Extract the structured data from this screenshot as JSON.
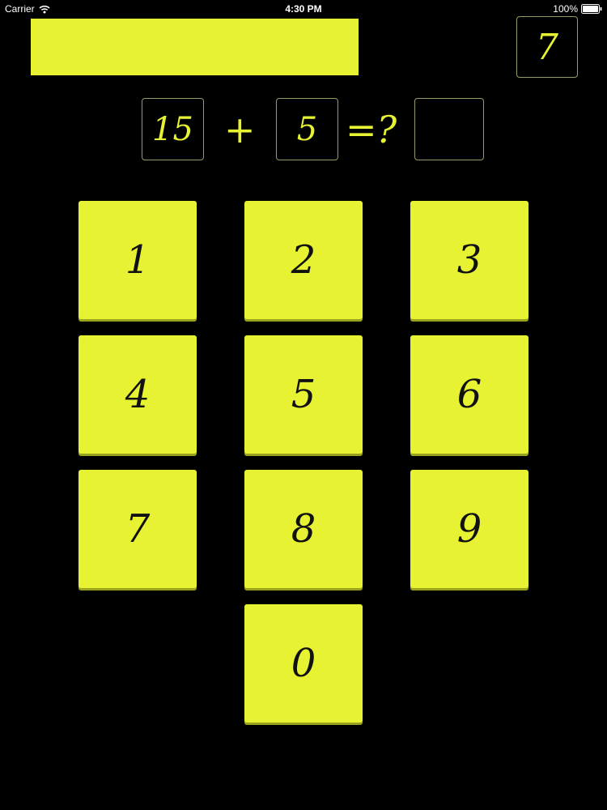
{
  "status_bar": {
    "carrier": "Carrier",
    "time": "4:30 PM",
    "battery": "100%",
    "icons": [
      "wifi-icon",
      "battery-icon"
    ]
  },
  "progress": {
    "fraction": 1.0,
    "color": "#e6f232"
  },
  "score": "7",
  "equation": {
    "operand_a": "15",
    "operator": "+",
    "operand_b": "5",
    "equals": "=?",
    "answer": ""
  },
  "keypad": {
    "keys": [
      "1",
      "2",
      "3",
      "4",
      "5",
      "6",
      "7",
      "8",
      "9",
      "0"
    ]
  },
  "colors": {
    "background": "#000000",
    "accent": "#e6f232",
    "key_text": "#111111",
    "box_border": "#9a9a66"
  }
}
